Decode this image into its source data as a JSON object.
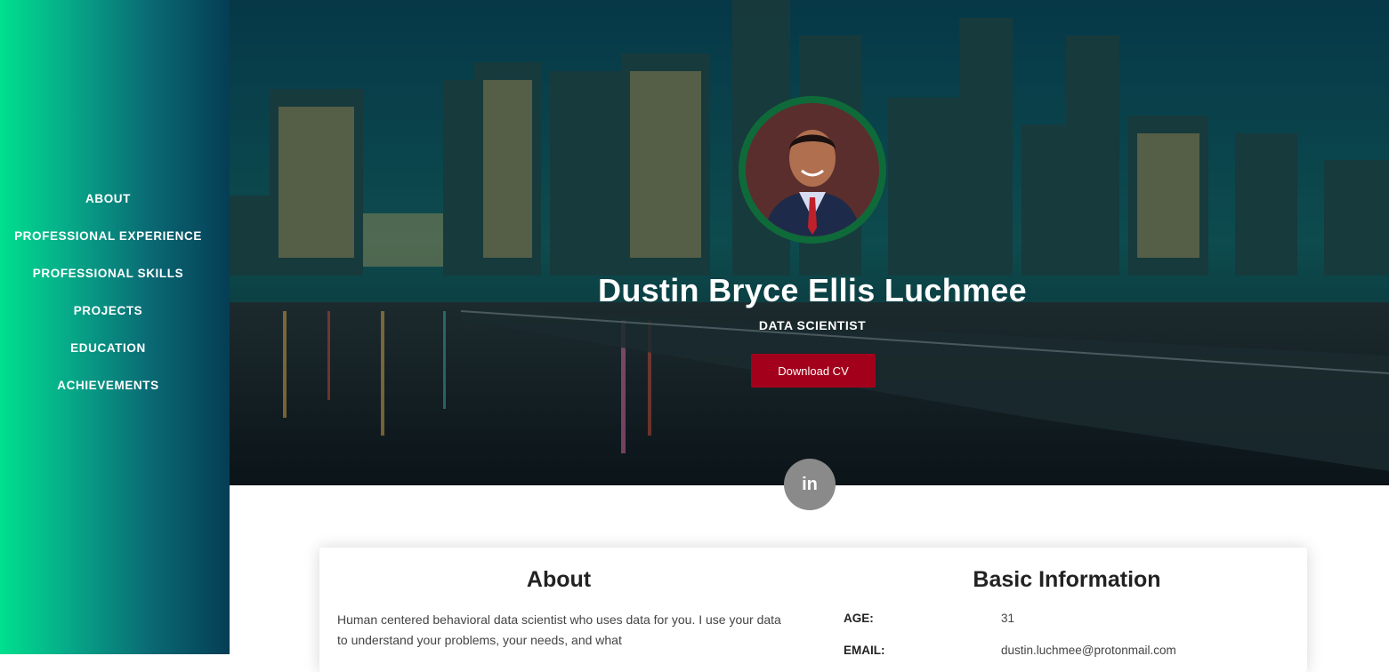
{
  "sidebar": {
    "items": [
      {
        "label": "ABOUT"
      },
      {
        "label": "PROFESSIONAL EXPERIENCE"
      },
      {
        "label": "PROFESSIONAL SKILLS"
      },
      {
        "label": "PROJECTS"
      },
      {
        "label": "EDUCATION"
      },
      {
        "label": "ACHIEVEMENTS"
      }
    ]
  },
  "hero": {
    "name": "Dustin Bryce Ellis Luchmee",
    "title": "DATA SCIENTIST",
    "cv_button": "Download CV"
  },
  "social": {
    "linkedin_label": "in"
  },
  "about": {
    "heading": "About",
    "text": "Human centered behavioral data scientist who uses data for you. I use your data to understand your problems, your needs, and what"
  },
  "basic_info": {
    "heading": "Basic Information",
    "rows": [
      {
        "label": "AGE:",
        "value": "31"
      },
      {
        "label": "EMAIL:",
        "value": "dustin.luchmee@protonmail.com"
      }
    ]
  },
  "colors": {
    "accent": "#a3001b",
    "sidebar_start": "#00e08e",
    "sidebar_end": "#053d55"
  }
}
